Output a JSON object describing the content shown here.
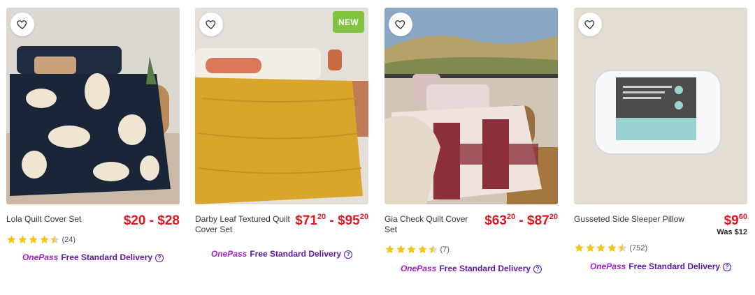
{
  "products": [
    {
      "title": "Lola Quilt Cover Set",
      "price": "$20 - $28",
      "rating_count": "(24)",
      "rating": 4.5,
      "delivery_brand": "OnePass",
      "delivery_text": "Free Standard Delivery",
      "favourite_icon": "heart-outline-icon"
    },
    {
      "title": "Darby Leaf Textured Quilt Cover Set",
      "price_low_main": "$71",
      "price_low_cents": "20",
      "price_sep": " - ",
      "price_high_main": "$95",
      "price_high_cents": "20",
      "badge": "NEW",
      "delivery_brand": "OnePass",
      "delivery_text": "Free Standard Delivery",
      "favourite_icon": "heart-outline-icon"
    },
    {
      "title": "Gia Check Quilt Cover Set",
      "price_low_main": "$63",
      "price_low_cents": "20",
      "price_sep": " - ",
      "price_high_main": "$87",
      "price_high_cents": "20",
      "rating_count": "(7)",
      "rating": 4.5,
      "delivery_brand": "OnePass",
      "delivery_text": "Free Standard Delivery",
      "favourite_icon": "heart-outline-icon"
    },
    {
      "title": "Gusseted Side Sleeper Pillow",
      "price_main": "$9",
      "price_cents": "60",
      "was_price": "Was $12",
      "rating_count": "(752)",
      "rating": 4.5,
      "delivery_brand": "OnePass",
      "delivery_text": "Free Standard Delivery",
      "favourite_icon": "heart-outline-icon"
    }
  ],
  "colors": {
    "price_red": "#e01a22",
    "onepass_purple": "#5c17a6",
    "star_yellow": "#f5c518",
    "new_badge_green": "#82c341"
  }
}
